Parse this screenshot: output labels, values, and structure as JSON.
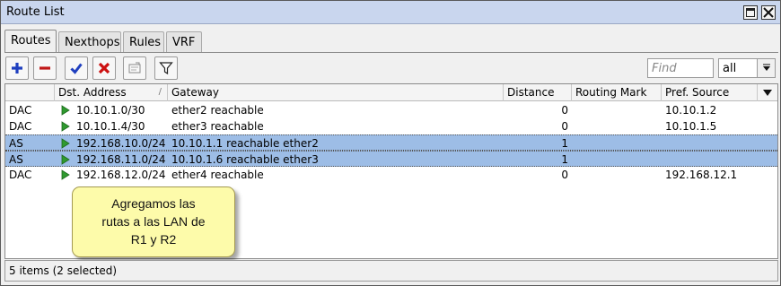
{
  "window": {
    "title": "Route List"
  },
  "tabs": [
    {
      "label": "Routes",
      "active": true
    },
    {
      "label": "Nexthops",
      "active": false
    },
    {
      "label": "Rules",
      "active": false
    },
    {
      "label": "VRF",
      "active": false
    }
  ],
  "toolbar": {
    "buttons": [
      "add-icon",
      "remove-icon",
      "enable-icon",
      "disable-icon",
      "comment-icon",
      "filter-icon"
    ],
    "find_placeholder": "Find",
    "find_value": "",
    "filter_select_value": "all"
  },
  "table": {
    "columns": [
      "",
      "Dst. Address",
      "Gateway",
      "Distance",
      "Routing Mark",
      "Pref. Source"
    ],
    "rows": [
      {
        "flags": "DAC",
        "dst": "10.10.1.0/30",
        "gateway": "ether2 reachable",
        "distance": "0",
        "routing_mark": "",
        "pref_source": "10.10.1.2",
        "selected": false
      },
      {
        "flags": "DAC",
        "dst": "10.10.1.4/30",
        "gateway": "ether3 reachable",
        "distance": "0",
        "routing_mark": "",
        "pref_source": "10.10.1.5",
        "selected": false
      },
      {
        "flags": "AS",
        "dst": "192.168.10.0/24",
        "gateway": "10.10.1.1 reachable ether2",
        "distance": "1",
        "routing_mark": "",
        "pref_source": "",
        "selected": true
      },
      {
        "flags": "AS",
        "dst": "192.168.11.0/24",
        "gateway": "10.10.1.6 reachable ether3",
        "distance": "1",
        "routing_mark": "",
        "pref_source": "",
        "selected": true
      },
      {
        "flags": "DAC",
        "dst": "192.168.12.0/24",
        "gateway": "ether4 reachable",
        "distance": "0",
        "routing_mark": "",
        "pref_source": "192.168.12.1",
        "selected": false
      }
    ]
  },
  "callout": {
    "lines": [
      "Agregamos las",
      "rutas a las LAN de",
      "R1 y R2"
    ]
  },
  "status": {
    "text": "5 items (2 selected)"
  },
  "colors": {
    "titlebar": "#c9d6ee",
    "selected_row": "#9dbde6",
    "callout_bg": "#fdfbaa",
    "add": "#1f3fbf",
    "remove": "#c01818",
    "enable": "#1f3fbf",
    "disable": "#cc1010",
    "route_flag": "#2f9a2f"
  }
}
